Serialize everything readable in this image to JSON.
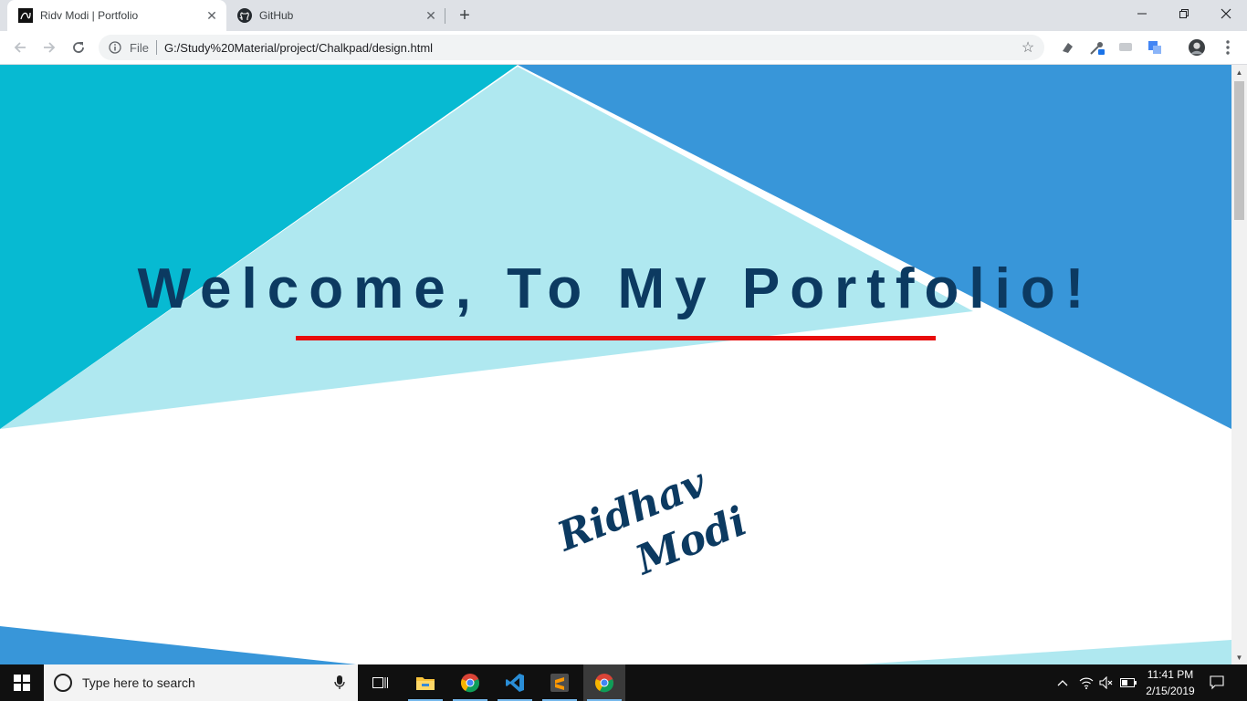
{
  "browser": {
    "tabs": [
      {
        "title": "Ridv Modi | Portfolio",
        "active": true
      },
      {
        "title": "GitHub",
        "active": false
      }
    ],
    "address": {
      "scheme_label": "File",
      "url": "G:/Study%20Material/project/Chalkpad/design.html"
    }
  },
  "page": {
    "headline": "Welcome, To My Portfolio!",
    "signature_line1": "Ridhav",
    "signature_line2": "Modi",
    "colors": {
      "cyan": "#07bad2",
      "light_cyan": "#afe8f0",
      "blue": "#3896d9",
      "navy": "#0c3a61",
      "accent_red": "#e80c0c"
    }
  },
  "taskbar": {
    "search_placeholder": "Type here to search",
    "time": "11:41 PM",
    "date": "2/15/2019",
    "pinned": [
      "task-view-icon",
      "file-explorer-icon",
      "chrome-icon",
      "vscode-icon",
      "sublime-text-icon",
      "chrome-icon"
    ]
  }
}
